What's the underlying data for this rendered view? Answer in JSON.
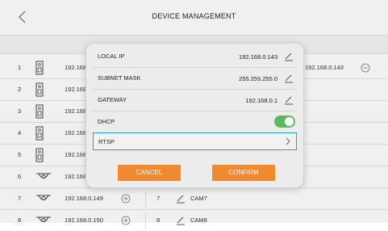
{
  "header": {
    "title": "DEVICE MANAGEMENT"
  },
  "devices": [
    {
      "num": "1",
      "ip": "192.168",
      "icon": "intercom-icon"
    },
    {
      "num": "2",
      "ip": "192.168",
      "icon": "intercom-icon"
    },
    {
      "num": "3",
      "ip": "192.168",
      "icon": "intercom-icon"
    },
    {
      "num": "4",
      "ip": "192.168",
      "icon": "intercom-icon"
    },
    {
      "num": "5",
      "ip": "192.168",
      "icon": "intercom-icon"
    },
    {
      "num": "6",
      "ip": "192.168",
      "icon": "camera-icon"
    },
    {
      "num": "7",
      "ip": "192.168.0.149",
      "icon": "camera-icon",
      "num2": "7",
      "cam": "CAM7"
    },
    {
      "num": "8",
      "ip": "192.168.0.150",
      "icon": "camera-icon",
      "num2": "8",
      "cam": "CAM8"
    }
  ],
  "right_ip": "192.168.0.143",
  "dialog": {
    "local_ip_label": "LOCAL IP",
    "local_ip_value": "192.168.0.143",
    "subnet_label": "SUBNET MASK",
    "subnet_value": "255.255.255.0",
    "gateway_label": "GATEWAY",
    "gateway_value": "192.168.0.1",
    "dhcp_label": "DHCP",
    "dhcp_enabled": true,
    "rtsp_label": "RTSP",
    "cancel_label": "CANCEL",
    "confirm_label": "CONFIRM"
  },
  "colors": {
    "accent": "#f08a30",
    "toggle_on": "#5cb85c",
    "focus_border": "#29a0d8"
  }
}
